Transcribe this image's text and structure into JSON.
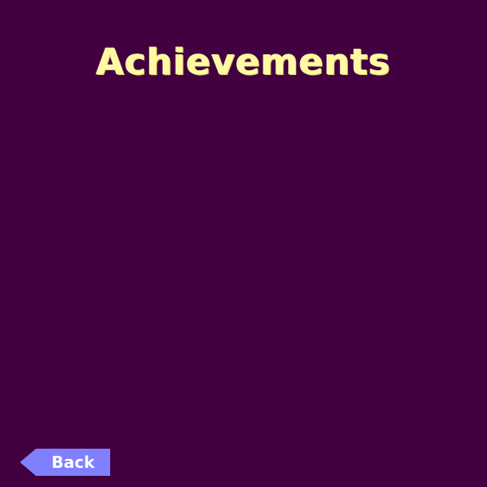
{
  "screen": {
    "title": "Achievements",
    "background_color": "#420040",
    "title_color": "#fff9a3"
  },
  "back_button": {
    "label": "Back",
    "color": "#8080ff",
    "icon": "left-arrow-icon"
  }
}
